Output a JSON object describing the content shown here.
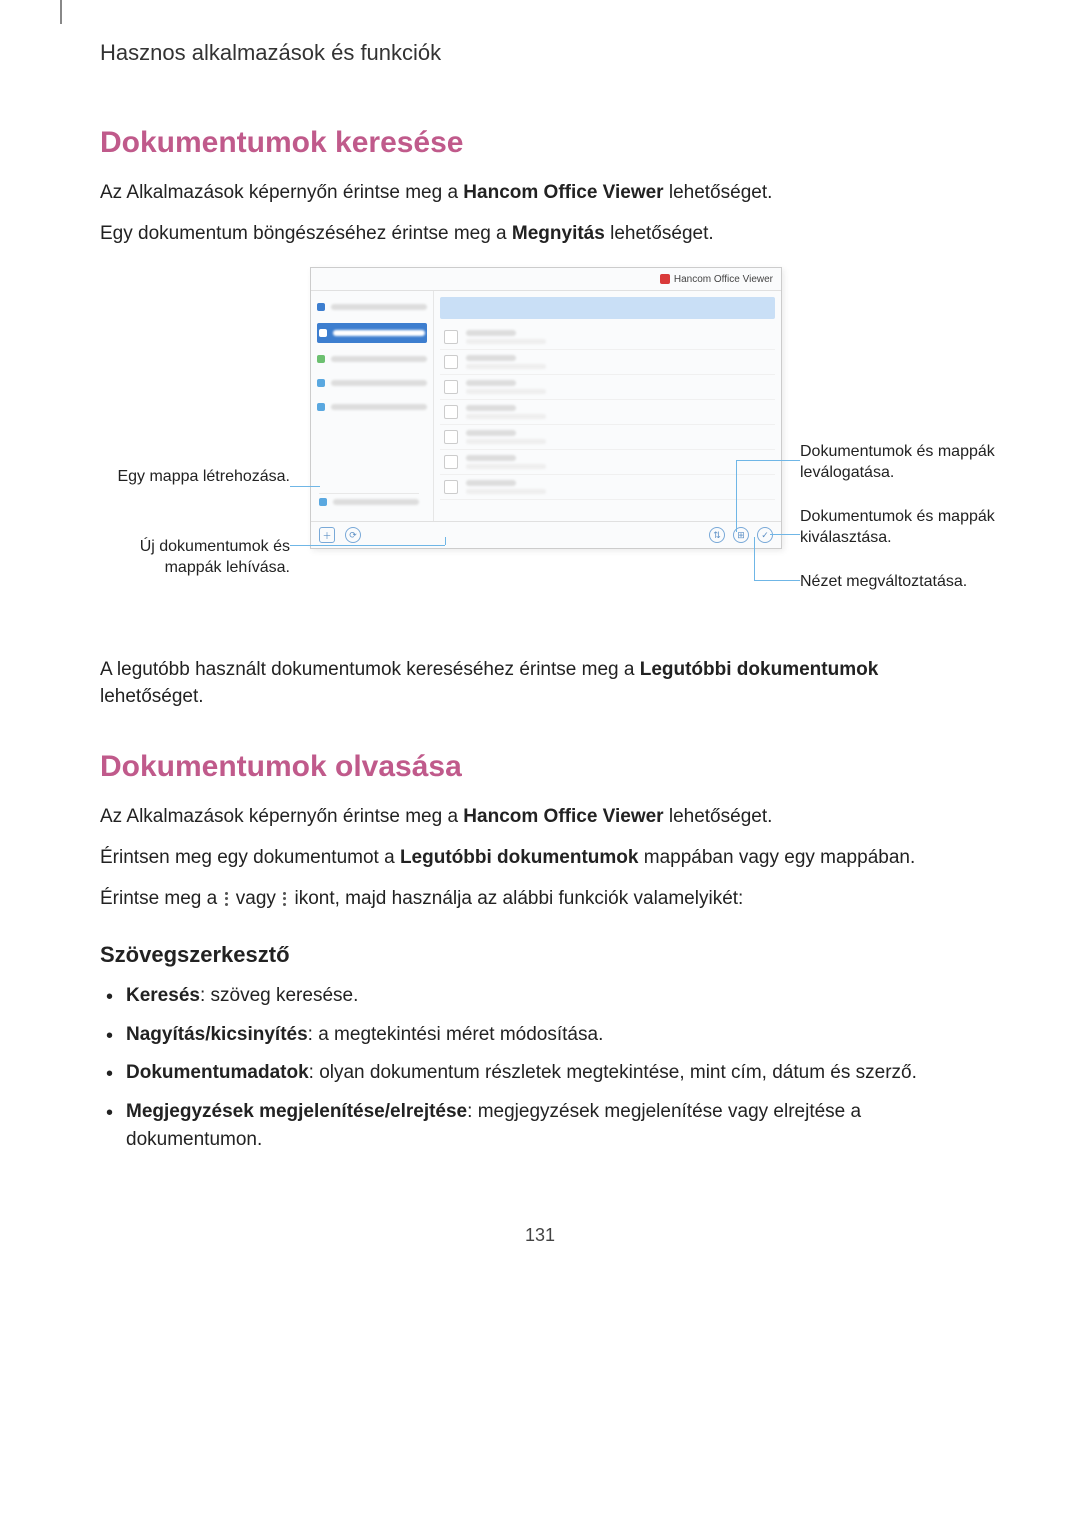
{
  "breadcrumb": "Hasznos alkalmazások és funkciók",
  "section1": {
    "title": "Dokumentumok keresése",
    "p1_a": "Az Alkalmazások képernyőn érintse meg a ",
    "p1_b": "Hancom Office Viewer",
    "p1_c": " lehetőséget.",
    "p2_a": "Egy dokumentum böngészéséhez érintse meg a ",
    "p2_b": "Megnyitás",
    "p2_c": " lehetőséget.",
    "p3_a": "A legutóbb használt dokumentumok kereséséhez érintse meg a ",
    "p3_b": "Legutóbbi dokumentumok",
    "p3_c": " lehetőséget."
  },
  "figure": {
    "app_brand": "Hancom Office Viewer",
    "callouts": {
      "create_folder": "Egy mappa létrehozása.",
      "new_docs": "Új dokumentumok és mappák lehívása.",
      "sort": "Dokumentumok és mappák leválogatása.",
      "select": "Dokumentumok és mappák kiválasztása.",
      "view": "Nézet megváltoztatása."
    }
  },
  "section2": {
    "title": "Dokumentumok olvasása",
    "p1_a": "Az Alkalmazások képernyőn érintse meg a ",
    "p1_b": "Hancom Office Viewer",
    "p1_c": " lehetőséget.",
    "p2_a": "Érintsen meg egy dokumentumot a ",
    "p2_b": "Legutóbbi dokumentumok",
    "p2_c": " mappában vagy egy mappában.",
    "p3_a": "Érintse meg a ",
    "p3_b": " vagy ",
    "p3_c": " ikont, majd használja az alábbi funkciók valamelyikét:"
  },
  "sub1": {
    "title": "Szövegszerkesztő",
    "items": [
      {
        "b": "Keresés",
        "t": ": szöveg keresése."
      },
      {
        "b": "Nagyítás/kicsinyítés",
        "t": ": a megtekintési méret módosítása."
      },
      {
        "b": "Dokumentumadatok",
        "t": ": olyan dokumentum részletek megtekintése, mint cím, dátum és szerző."
      },
      {
        "b": "Megjegyzések megjelenítése/elrejtése",
        "t": ": megjegyzések megjelenítése vagy elrejtése a dokumentumon."
      }
    ]
  },
  "page_number": "131"
}
